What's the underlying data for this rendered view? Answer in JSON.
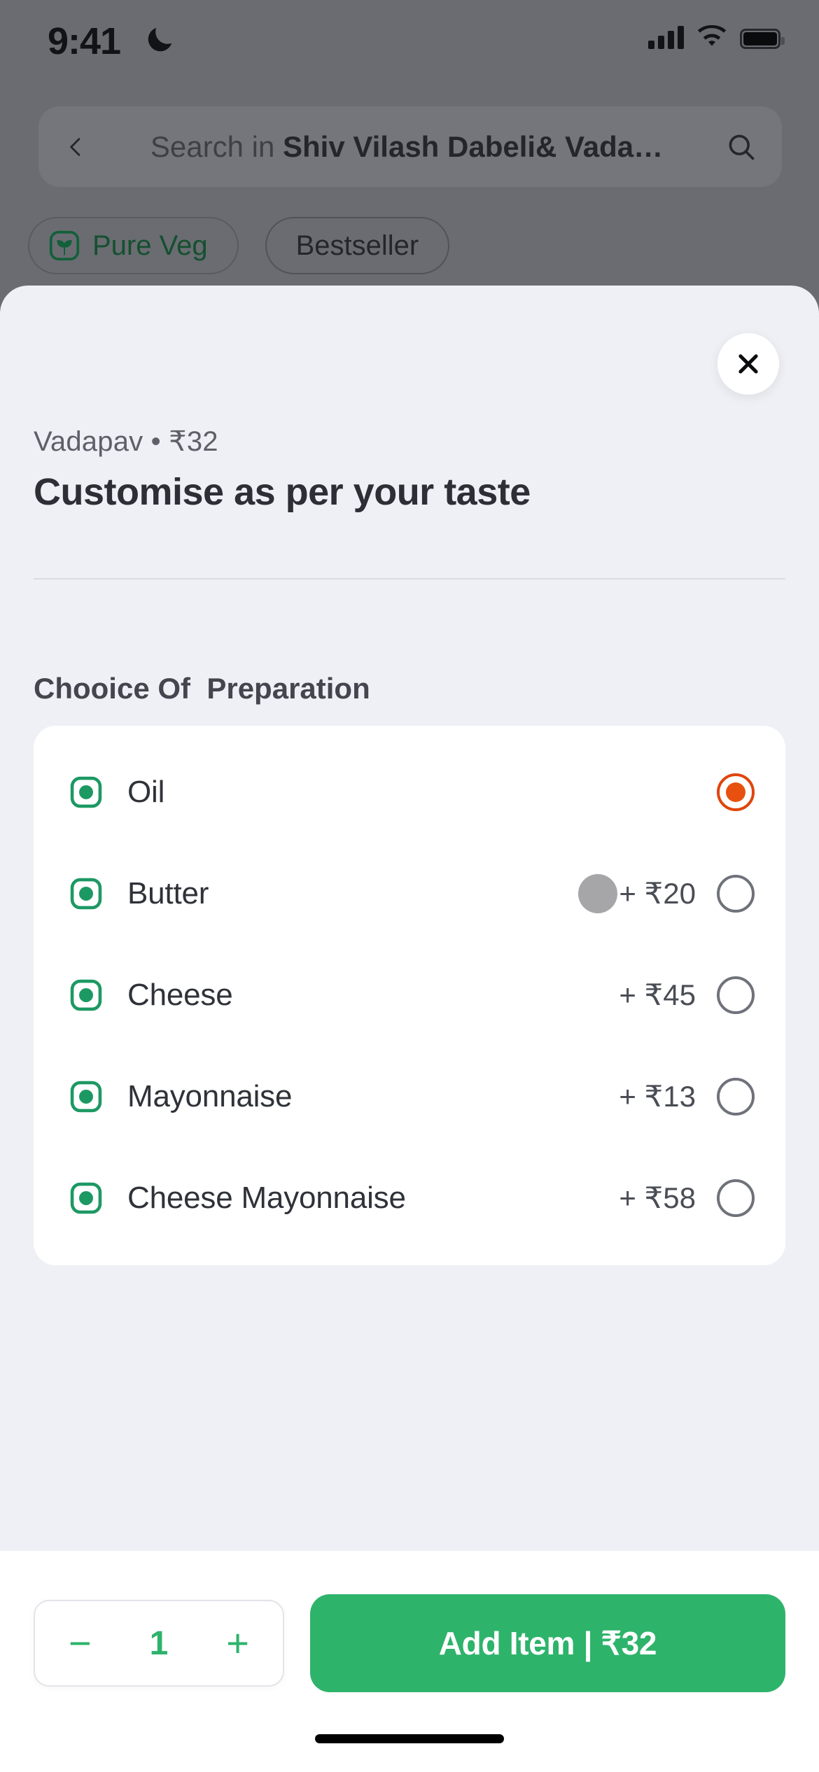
{
  "status_bar": {
    "time": "9:41",
    "dnd_icon": "moon-icon",
    "signal_icon": "cellular-signal-icon",
    "wifi_icon": "wifi-icon",
    "battery_icon": "battery-full-icon"
  },
  "search": {
    "back_icon": "chevron-left-icon",
    "prefix": "Search in ",
    "restaurant": "Shiv Vilash Dabeli& Vada…",
    "search_icon": "magnifier-icon"
  },
  "filters": {
    "chips": [
      {
        "label": "Pure Veg",
        "icon": "pure-veg-leaf-icon",
        "active": true
      },
      {
        "label": "Bestseller",
        "icon": null,
        "active": false
      }
    ]
  },
  "sheet": {
    "close_icon": "close-x-icon",
    "subtitle": "Vadapav • ₹32",
    "title": "Customise as per your taste",
    "group_title": "Chooice Of  Preparation",
    "options": [
      {
        "label": "Oil",
        "price": "",
        "selected": true,
        "veg_icon": "veg-mark-icon"
      },
      {
        "label": "Butter",
        "price": "+ ₹20",
        "selected": false,
        "veg_icon": "veg-mark-icon"
      },
      {
        "label": "Cheese",
        "price": "+ ₹45",
        "selected": false,
        "veg_icon": "veg-mark-icon"
      },
      {
        "label": "Mayonnaise",
        "price": "+ ₹13",
        "selected": false,
        "veg_icon": "veg-mark-icon"
      },
      {
        "label": "Cheese Mayonnaise",
        "price": "+ ₹58",
        "selected": false,
        "veg_icon": "veg-mark-icon"
      }
    ]
  },
  "bottom_bar": {
    "decrement_label": "−",
    "quantity": "1",
    "increment_label": "+",
    "add_label": "Add Item | ₹32"
  },
  "colors": {
    "accent_green": "#2eb36b",
    "veg_green": "#1c9963",
    "selected_radio": "#e8500f",
    "sheet_bg": "#eff0f5",
    "overlay": "#6a6c72"
  }
}
